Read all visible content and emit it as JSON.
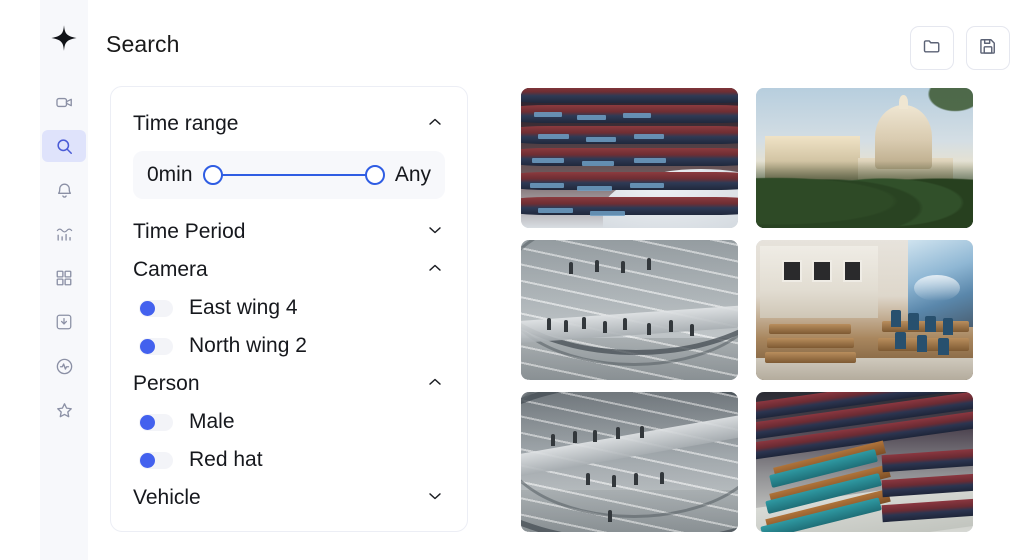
{
  "app": {
    "logo_icon": "sparkle-logo-icon",
    "title": "Search"
  },
  "sidebar": {
    "items": [
      {
        "icon": "video-camera-icon",
        "name": "cameras",
        "active": false
      },
      {
        "icon": "search-icon",
        "name": "search",
        "active": true
      },
      {
        "icon": "bell-icon",
        "name": "alerts",
        "active": false
      },
      {
        "icon": "analytics-chart-icon",
        "name": "analytics",
        "active": false
      },
      {
        "icon": "grid-dashboard-icon",
        "name": "dashboard",
        "active": false
      },
      {
        "icon": "download-box-icon",
        "name": "downloads",
        "active": false
      },
      {
        "icon": "activity-pulse-icon",
        "name": "activity",
        "active": false
      },
      {
        "icon": "star-icon",
        "name": "favorites",
        "active": false
      }
    ]
  },
  "header": {
    "actions": [
      {
        "icon": "folder-open-icon",
        "name": "open-folder-button"
      },
      {
        "icon": "save-disk-icon",
        "name": "save-button"
      }
    ]
  },
  "filters": {
    "sections": [
      {
        "id": "time-range",
        "title": "Time range",
        "expanded": true,
        "chevron": "chevron-up-icon",
        "slider": {
          "min_label": "0min",
          "max_label": "Any",
          "left_handle_pct": 0,
          "right_handle_pct": 100
        }
      },
      {
        "id": "time-period",
        "title": "Time Period",
        "expanded": false,
        "chevron": "chevron-down-icon"
      },
      {
        "id": "camera",
        "title": "Camera",
        "expanded": true,
        "chevron": "chevron-up-icon",
        "options": [
          {
            "label": "East wing 4",
            "enabled": true
          },
          {
            "label": "North wing 2",
            "enabled": true
          }
        ]
      },
      {
        "id": "person",
        "title": "Person",
        "expanded": true,
        "chevron": "chevron-up-icon",
        "options": [
          {
            "label": "Male",
            "enabled": true
          },
          {
            "label": "Red hat",
            "enabled": true
          }
        ]
      },
      {
        "id": "vehicle",
        "title": "Vehicle",
        "expanded": false,
        "chevron": "chevron-down-icon"
      }
    ]
  },
  "results": {
    "thumbnails": [
      {
        "id": "result-1",
        "alt": "Parliament chamber with tiered maroon benches and blue desks"
      },
      {
        "id": "result-2",
        "alt": "United States Capitol dome at golden hour with trees"
      },
      {
        "id": "result-3",
        "alt": "Glass dome interior with visitors on walkway"
      },
      {
        "id": "result-4",
        "alt": "Wood-panelled parliament chamber with painted mural"
      },
      {
        "id": "result-5",
        "alt": "Reichstag glass dome spiral ramp with visitors"
      },
      {
        "id": "result-6",
        "alt": "Assembly hall with teal desks and red tiered seating"
      }
    ]
  },
  "colors": {
    "accent": "#4361ee",
    "slider_blue": "#2f5de3",
    "active_nav_bg": "#dfe3fb",
    "active_nav_fg": "#4a5bd6",
    "rail_bg": "#f7f8fb",
    "panel_border": "#eceef5",
    "text": "#16181d"
  }
}
